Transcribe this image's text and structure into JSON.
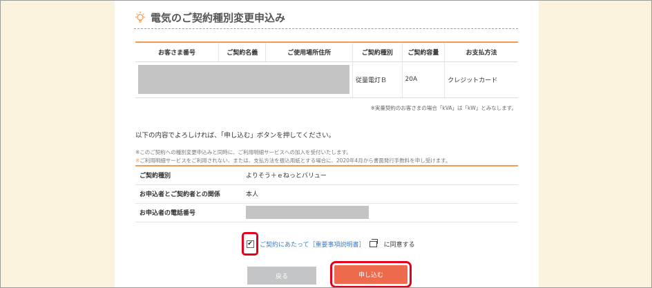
{
  "page": {
    "title": "電気のご契約種別変更申込み"
  },
  "contract_table": {
    "headers": [
      "お客さま番号",
      "ご契約名義",
      "ご使用場所住所",
      "ご契約種別",
      "ご契約容量",
      "お支払方法"
    ],
    "row": {
      "contract_type": "従量電灯Ｂ",
      "capacity": "20A",
      "payment": "クレジットカード"
    },
    "note": "※実量契約のお客さまの場合「kVA」は「kW」とみなします。"
  },
  "intro_text": "以下の内容でよろしければ、「申し込む」ボタンを押してください。",
  "notices": {
    "line1": "※このご契約への種別変更申込みと同時に、ご利用明細サービスへの加入を受付いたします。",
    "line2_mark": "※",
    "line2": "ご利用明細サービスをご利用されない、または、支払方法を振込用紙とする場合に、2020年4月から書面発行手数料を申し受けます。"
  },
  "details": {
    "rows": [
      {
        "label": "ご契約種別",
        "value": "よりそう＋ｅねっとバリュー"
      },
      {
        "label": "お申込者とご契約者との関係",
        "value": "本人"
      },
      {
        "label": "お申込者の電話番号",
        "value": ""
      }
    ]
  },
  "agreement": {
    "checked_glyph": "✔",
    "link_text": "ご契約にあたって［重要事項説明書］",
    "suffix": "に同意する"
  },
  "buttons": {
    "back": "戻る",
    "apply": "申し込む"
  },
  "colors": {
    "accent": "#f39a55",
    "highlight": "#e4001c",
    "apply": "#ee6a4d"
  }
}
